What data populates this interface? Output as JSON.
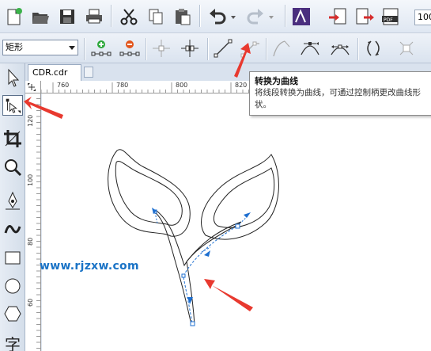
{
  "toolbar": {
    "zoom_value": "100",
    "shape_dropdown": "矩形",
    "icons": [
      "new-icon",
      "open-icon",
      "save-icon",
      "print-icon",
      "cut-icon",
      "copy-icon",
      "paste-icon",
      "undo-icon",
      "redo-icon",
      "app-launcher-icon",
      "import-icon",
      "export-icon",
      "pdf-icon"
    ],
    "pdf_label": "PDF"
  },
  "document": {
    "tab_label": "CDR.cdr"
  },
  "ruler": {
    "h_labels": [
      "760",
      "780",
      "800",
      "820"
    ],
    "v_labels": [
      "120",
      "100",
      "80",
      "60"
    ]
  },
  "tooltip": {
    "title": "转换为曲线",
    "body": "将线段转换为曲线，可通过控制柄更改曲线形状。"
  },
  "watermark": "www.rjzxw.com",
  "colors": {
    "arrow": "#e8392f",
    "accent": "#1a73c6",
    "node": "#1e6fd0"
  }
}
